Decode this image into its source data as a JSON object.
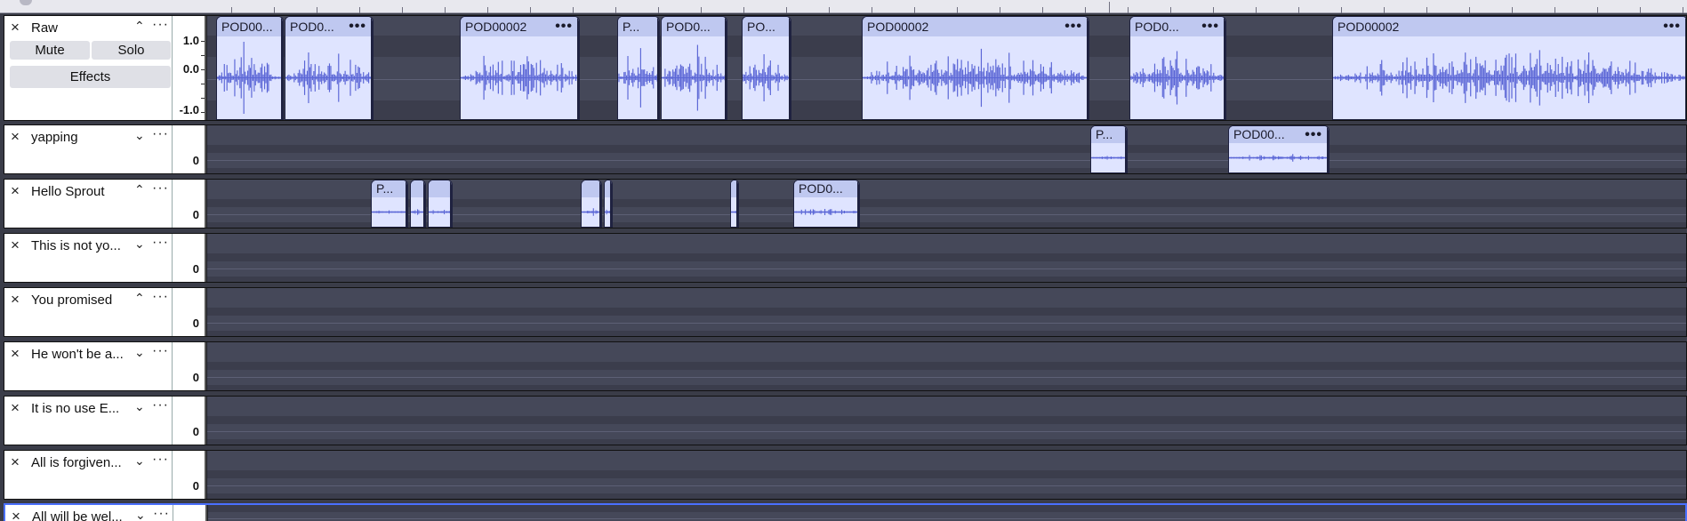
{
  "ruler": {
    "label": "timeline-ruler"
  },
  "tracks": [
    {
      "name": "Raw",
      "chevron": "^",
      "more": "···",
      "close": "×",
      "mute": "Mute",
      "solo": "Solo",
      "effects": "Effects",
      "scale": [
        "1.0",
        "0.0",
        "-1.0"
      ],
      "clips": [
        {
          "label": "POD00...",
          "dots": ""
        },
        {
          "label": "POD0...",
          "dots": "•••"
        },
        {
          "label": "POD00002",
          "dots": "•••"
        },
        {
          "label": "P...",
          "dots": ""
        },
        {
          "label": "POD0...",
          "dots": ""
        },
        {
          "label": "PO...",
          "dots": ""
        },
        {
          "label": "POD00002",
          "dots": "•••"
        },
        {
          "label": "POD0...",
          "dots": "•••"
        },
        {
          "label": "POD00002",
          "dots": "•••"
        }
      ]
    },
    {
      "name": "yapping",
      "chevron": "v",
      "more": "···",
      "close": "×",
      "scale": [
        "0"
      ],
      "clips": [
        {
          "label": "P...",
          "dots": ""
        },
        {
          "label": "POD00...",
          "dots": "•••"
        }
      ]
    },
    {
      "name": "Hello Sprout",
      "chevron": "^",
      "more": "···",
      "close": "×",
      "scale": [
        "0"
      ],
      "clips": [
        {
          "label": "P...",
          "dots": ""
        },
        {
          "label": "",
          "dots": ""
        },
        {
          "label": "",
          "dots": ""
        },
        {
          "label": "",
          "dots": ""
        },
        {
          "label": "",
          "dots": ""
        },
        {
          "label": "",
          "dots": ""
        },
        {
          "label": "POD0...",
          "dots": ""
        }
      ]
    },
    {
      "name": "This is not yo...",
      "chevron": "v",
      "more": "···",
      "close": "×",
      "scale": [
        "0"
      ],
      "clips": []
    },
    {
      "name": "You promised",
      "chevron": "^",
      "more": "···",
      "close": "×",
      "scale": [
        "0"
      ],
      "clips": []
    },
    {
      "name": "He won't be a...",
      "chevron": "v",
      "more": "···",
      "close": "×",
      "scale": [
        "0"
      ],
      "clips": []
    },
    {
      "name": "It is no use E...",
      "chevron": "v",
      "more": "···",
      "close": "×",
      "scale": [
        "0"
      ],
      "clips": []
    },
    {
      "name": "All is forgiven...",
      "chevron": "v",
      "more": "···",
      "close": "×",
      "scale": [
        "0"
      ],
      "clips": []
    },
    {
      "name": "All will be wel...",
      "chevron": "v",
      "more": "···",
      "close": "×",
      "scale": [],
      "clips": [],
      "selected": true
    }
  ],
  "colors": {
    "waveform": "#5b66d6",
    "clip_body": "#dfe4ff",
    "clip_header": "#bfc8f0",
    "lane": "#454859",
    "selection": "#4a70ff"
  }
}
